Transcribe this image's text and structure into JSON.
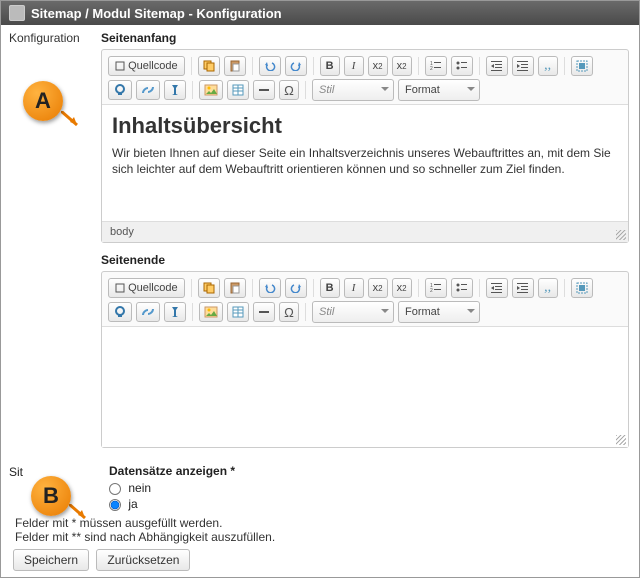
{
  "header": {
    "breadcrumb": "Sitemap / Modul Sitemap - Konfiguration"
  },
  "left": {
    "tab": "Konfiguration",
    "sitemap_short": "Sit"
  },
  "sections": {
    "top_label": "Seitenanfang",
    "bottom_label": "Seitenende",
    "records_label": "Datensätze anzeigen *"
  },
  "toolbar": {
    "source": "Quellcode",
    "style": "Stil",
    "format": "Format"
  },
  "editor1": {
    "heading": "Inhaltsübersicht",
    "body": "Wir bieten Ihnen auf dieser Seite ein Inhaltsverzeichnis unseres Webauftrittes an, mit dem Sie sich leichter auf dem Webauftritt orientieren können und so schneller zum Ziel finden.",
    "path": "body"
  },
  "records": {
    "option_no": "nein",
    "option_yes": "ja",
    "selected": "ja"
  },
  "notes": {
    "required": "Felder mit * müssen ausgefüllt werden.",
    "dependent": "Felder mit ** sind nach Abhängigkeit auszufüllen."
  },
  "actions": {
    "save": "Speichern",
    "reset": "Zurücksetzen"
  },
  "callouts": {
    "a": "A",
    "b": "B"
  }
}
